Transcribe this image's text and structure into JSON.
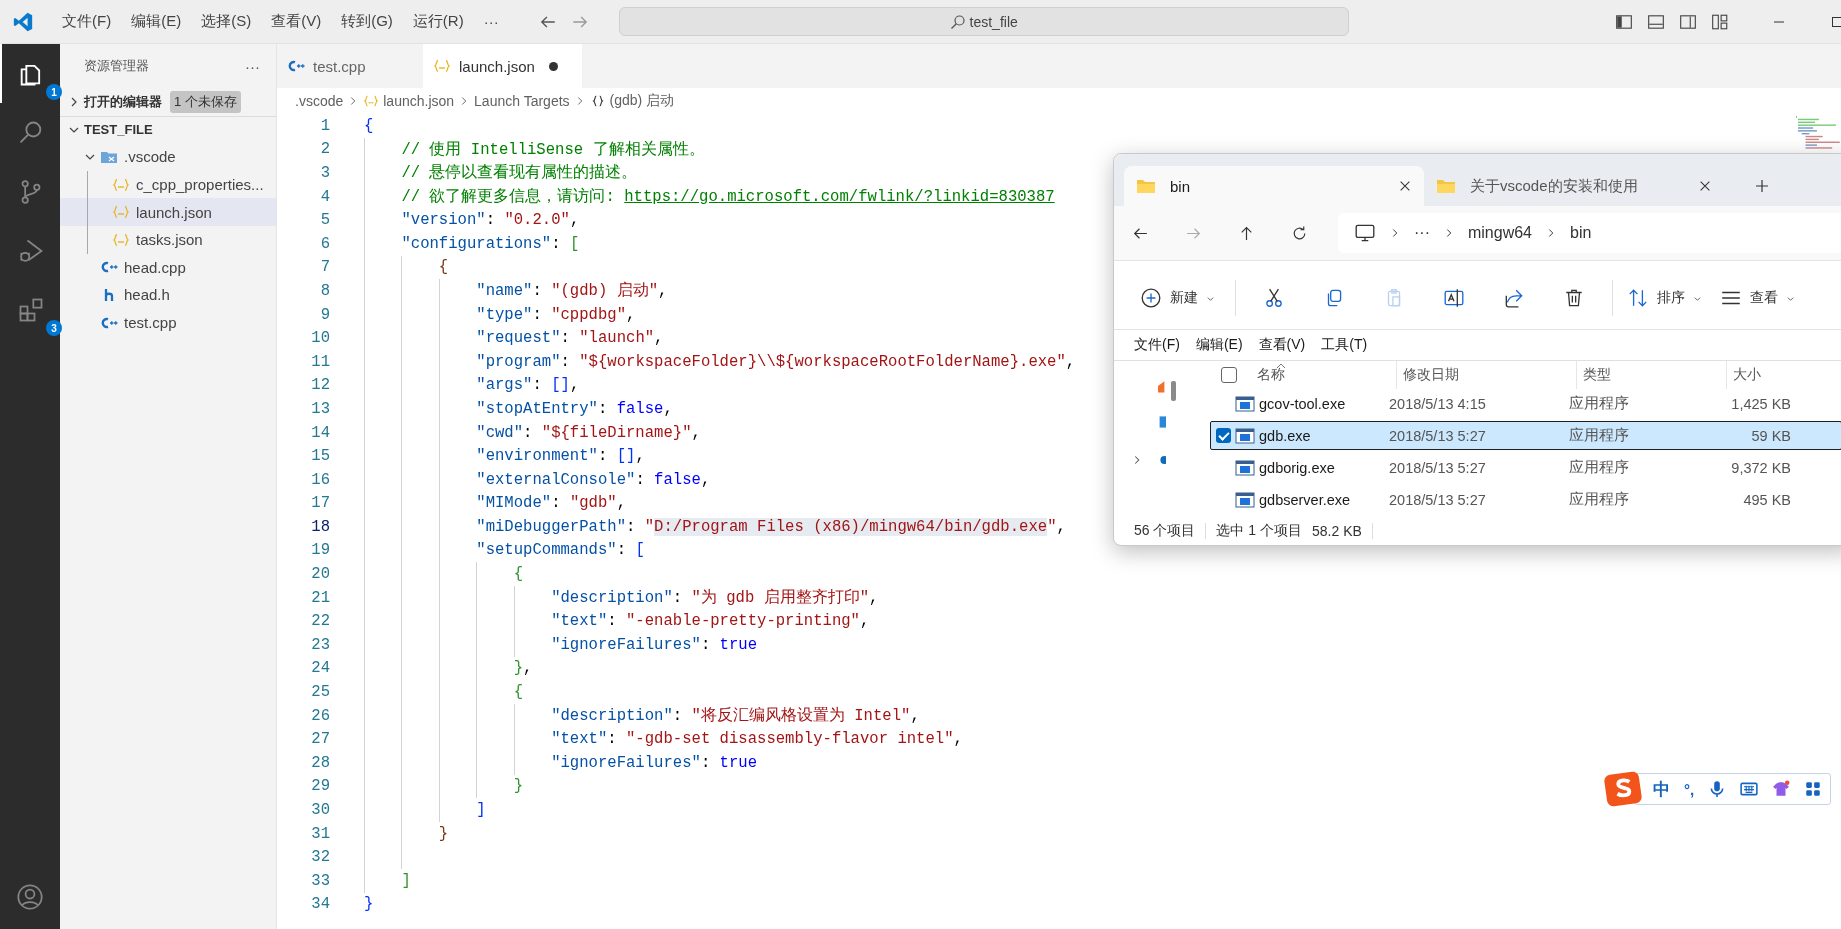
{
  "title_bar": {
    "menu": [
      "文件(F)",
      "编辑(E)",
      "选择(S)",
      "查看(V)",
      "转到(G)",
      "运行(R)"
    ],
    "more": "···",
    "search": "test_file"
  },
  "activity_bar": {
    "items": [
      {
        "kind": "explorer",
        "selected": true,
        "badge": "1"
      },
      {
        "kind": "search",
        "selected": false
      },
      {
        "kind": "scm",
        "selected": false
      },
      {
        "kind": "debug",
        "selected": false
      },
      {
        "kind": "extensions",
        "selected": false,
        "badge": "3"
      }
    ]
  },
  "sidebar": {
    "title": "资源管理器",
    "more": "···",
    "open_editors": {
      "label": "打开的编辑器",
      "badge": "1 个未保存",
      "expanded": false
    },
    "root": {
      "label": "TEST_FILE",
      "expanded": true,
      "children": [
        {
          "name": ".vscode",
          "kind": "folder",
          "expanded": true,
          "selected": false,
          "children": [
            {
              "name": "c_cpp_properties...",
              "kind": "json",
              "selected": false
            },
            {
              "name": "launch.json",
              "kind": "json",
              "selected": true
            },
            {
              "name": "tasks.json",
              "kind": "json",
              "selected": false
            }
          ]
        },
        {
          "name": "head.cpp",
          "kind": "cpp",
          "selected": false
        },
        {
          "name": "head.h",
          "kind": "h",
          "selected": false
        },
        {
          "name": "test.cpp",
          "kind": "cpp",
          "selected": false
        }
      ]
    }
  },
  "editor": {
    "tabs": [
      {
        "label": "test.cpp",
        "kind": "cpp",
        "selected": false,
        "dirty": false
      },
      {
        "label": "launch.json",
        "kind": "json",
        "selected": true,
        "dirty": true
      }
    ],
    "breadcrumb": [
      {
        "label": ".vscode",
        "kind": "text"
      },
      {
        "label": "launch.json",
        "kind": "json"
      },
      {
        "label": "Launch Targets",
        "kind": "text"
      },
      {
        "label": "(gdb) 启动",
        "kind": "object"
      }
    ],
    "lines": [
      {
        "n": "1",
        "current": false,
        "tokens": [
          {
            "kind": "bracket1",
            "text": "{"
          }
        ],
        "children": [
          {
            "n": "2",
            "current": false,
            "tokens": [
              {
                "kind": "comment",
                "text": "// 使用 IntelliSense 了解相关属性。"
              }
            ]
          },
          {
            "n": "3",
            "current": false,
            "tokens": [
              {
                "kind": "comment",
                "text": "// 悬停以查看现有属性的描述。"
              }
            ]
          },
          {
            "n": "4",
            "current": false,
            "tokens": [
              {
                "kind": "comment",
                "text": "// 欲了解更多信息，请访问: "
              },
              {
                "kind": "link",
                "text": "https://go.microsoft.com/fwlink/?linkid=830387"
              }
            ]
          },
          {
            "n": "5",
            "current": false,
            "tokens": [
              {
                "kind": "key",
                "text": "\"version\""
              },
              {
                "kind": "punct",
                "text": ": "
              },
              {
                "kind": "string",
                "text": "\"0.2.0\""
              },
              {
                "kind": "punct",
                "text": ","
              }
            ]
          },
          {
            "n": "6",
            "current": false,
            "tokens": [
              {
                "kind": "key",
                "text": "\"configurations\""
              },
              {
                "kind": "punct",
                "text": ": "
              },
              {
                "kind": "bracket2",
                "text": "["
              }
            ],
            "children": [
              {
                "n": "7",
                "current": false,
                "tokens": [
                  {
                    "kind": "bracket3",
                    "text": "{"
                  }
                ],
                "children": [
                  {
                    "n": "8",
                    "current": false,
                    "tokens": [
                      {
                        "kind": "key",
                        "text": "\"name\""
                      },
                      {
                        "kind": "punct",
                        "text": ": "
                      },
                      {
                        "kind": "string",
                        "text": "\"(gdb) 启动\""
                      },
                      {
                        "kind": "punct",
                        "text": ","
                      }
                    ]
                  },
                  {
                    "n": "9",
                    "current": false,
                    "tokens": [
                      {
                        "kind": "key",
                        "text": "\"type\""
                      },
                      {
                        "kind": "punct",
                        "text": ": "
                      },
                      {
                        "kind": "string",
                        "text": "\"cppdbg\""
                      },
                      {
                        "kind": "punct",
                        "text": ","
                      }
                    ]
                  },
                  {
                    "n": "10",
                    "current": false,
                    "tokens": [
                      {
                        "kind": "key",
                        "text": "\"request\""
                      },
                      {
                        "kind": "punct",
                        "text": ": "
                      },
                      {
                        "kind": "string",
                        "text": "\"launch\""
                      },
                      {
                        "kind": "punct",
                        "text": ","
                      }
                    ]
                  },
                  {
                    "n": "11",
                    "current": false,
                    "tokens": [
                      {
                        "kind": "key",
                        "text": "\"program\""
                      },
                      {
                        "kind": "punct",
                        "text": ": "
                      },
                      {
                        "kind": "string",
                        "text": "\"${workspaceFolder}\\\\${workspaceRootFolderName}.exe\""
                      },
                      {
                        "kind": "punct",
                        "text": ","
                      }
                    ]
                  },
                  {
                    "n": "12",
                    "current": false,
                    "tokens": [
                      {
                        "kind": "key",
                        "text": "\"args\""
                      },
                      {
                        "kind": "punct",
                        "text": ": "
                      },
                      {
                        "kind": "bracket1",
                        "text": "[]"
                      },
                      {
                        "kind": "punct",
                        "text": ","
                      }
                    ]
                  },
                  {
                    "n": "13",
                    "current": false,
                    "tokens": [
                      {
                        "kind": "key",
                        "text": "\"stopAtEntry\""
                      },
                      {
                        "kind": "punct",
                        "text": ": "
                      },
                      {
                        "kind": "bool",
                        "text": "false"
                      },
                      {
                        "kind": "punct",
                        "text": ","
                      }
                    ]
                  },
                  {
                    "n": "14",
                    "current": false,
                    "tokens": [
                      {
                        "kind": "key",
                        "text": "\"cwd\""
                      },
                      {
                        "kind": "punct",
                        "text": ": "
                      },
                      {
                        "kind": "string",
                        "text": "\"${fileDirname}\""
                      },
                      {
                        "kind": "punct",
                        "text": ","
                      }
                    ]
                  },
                  {
                    "n": "15",
                    "current": false,
                    "tokens": [
                      {
                        "kind": "key",
                        "text": "\"environment\""
                      },
                      {
                        "kind": "punct",
                        "text": ": "
                      },
                      {
                        "kind": "bracket1",
                        "text": "[]"
                      },
                      {
                        "kind": "punct",
                        "text": ","
                      }
                    ]
                  },
                  {
                    "n": "16",
                    "current": false,
                    "tokens": [
                      {
                        "kind": "key",
                        "text": "\"externalConsole\""
                      },
                      {
                        "kind": "punct",
                        "text": ": "
                      },
                      {
                        "kind": "bool",
                        "text": "false"
                      },
                      {
                        "kind": "punct",
                        "text": ","
                      }
                    ]
                  },
                  {
                    "n": "17",
                    "current": false,
                    "tokens": [
                      {
                        "kind": "key",
                        "text": "\"MIMode\""
                      },
                      {
                        "kind": "punct",
                        "text": ": "
                      },
                      {
                        "kind": "string",
                        "text": "\"gdb\""
                      },
                      {
                        "kind": "punct",
                        "text": ","
                      }
                    ]
                  },
                  {
                    "n": "18",
                    "current": true,
                    "tokens": [
                      {
                        "kind": "key",
                        "text": "\"miDebuggerPath\""
                      },
                      {
                        "kind": "punct",
                        "text": ": "
                      },
                      {
                        "kind": "string",
                        "text": "\""
                      },
                      {
                        "kind": "string-selected",
                        "text": "D:/Program Files (x86)/mingw64/bin/gdb.exe"
                      },
                      {
                        "kind": "string",
                        "text": "\""
                      },
                      {
                        "kind": "punct",
                        "text": ","
                      }
                    ]
                  },
                  {
                    "n": "19",
                    "current": false,
                    "tokens": [
                      {
                        "kind": "key",
                        "text": "\"setupCommands\""
                      },
                      {
                        "kind": "punct",
                        "text": ": "
                      },
                      {
                        "kind": "bracket1",
                        "text": "["
                      }
                    ],
                    "children": [
                      {
                        "n": "20",
                        "current": false,
                        "tokens": [
                          {
                            "kind": "bracket2",
                            "text": "{"
                          }
                        ],
                        "children": [
                          {
                            "n": "21",
                            "current": false,
                            "tokens": [
                              {
                                "kind": "key",
                                "text": "\"description\""
                              },
                              {
                                "kind": "punct",
                                "text": ": "
                              },
                              {
                                "kind": "string",
                                "text": "\"为 gdb 启用整齐打印\""
                              },
                              {
                                "kind": "punct",
                                "text": ","
                              }
                            ]
                          },
                          {
                            "n": "22",
                            "current": false,
                            "tokens": [
                              {
                                "kind": "key",
                                "text": "\"text\""
                              },
                              {
                                "kind": "punct",
                                "text": ": "
                              },
                              {
                                "kind": "string",
                                "text": "\"-enable-pretty-printing\""
                              },
                              {
                                "kind": "punct",
                                "text": ","
                              }
                            ]
                          },
                          {
                            "n": "23",
                            "current": false,
                            "tokens": [
                              {
                                "kind": "key",
                                "text": "\"ignoreFailures\""
                              },
                              {
                                "kind": "punct",
                                "text": ": "
                              },
                              {
                                "kind": "bool",
                                "text": "true"
                              }
                            ]
                          }
                        ]
                      },
                      {
                        "n": "24",
                        "current": false,
                        "tokens": [
                          {
                            "kind": "bracket2",
                            "text": "}"
                          },
                          {
                            "kind": "punct",
                            "text": ","
                          }
                        ]
                      },
                      {
                        "n": "25",
                        "current": false,
                        "tokens": [
                          {
                            "kind": "bracket2",
                            "text": "{"
                          }
                        ],
                        "children": [
                          {
                            "n": "26",
                            "current": false,
                            "tokens": [
                              {
                                "kind": "key",
                                "text": "\"description\""
                              },
                              {
                                "kind": "punct",
                                "text": ": "
                              },
                              {
                                "kind": "string",
                                "text": "\"将反汇编风格设置为 Intel\""
                              },
                              {
                                "kind": "punct",
                                "text": ","
                              }
                            ]
                          },
                          {
                            "n": "27",
                            "current": false,
                            "tokens": [
                              {
                                "kind": "key",
                                "text": "\"text\""
                              },
                              {
                                "kind": "punct",
                                "text": ": "
                              },
                              {
                                "kind": "string",
                                "text": "\"-gdb-set disassembly-flavor intel\""
                              },
                              {
                                "kind": "punct",
                                "text": ","
                              }
                            ]
                          },
                          {
                            "n": "28",
                            "current": false,
                            "tokens": [
                              {
                                "kind": "key",
                                "text": "\"ignoreFailures\""
                              },
                              {
                                "kind": "punct",
                                "text": ": "
                              },
                              {
                                "kind": "bool",
                                "text": "true"
                              }
                            ]
                          }
                        ]
                      },
                      {
                        "n": "29",
                        "current": false,
                        "tokens": [
                          {
                            "kind": "bracket2",
                            "text": "}"
                          }
                        ]
                      }
                    ]
                  },
                  {
                    "n": "30",
                    "current": false,
                    "tokens": [
                      {
                        "kind": "bracket1",
                        "text": "]"
                      }
                    ]
                  }
                ]
              },
              {
                "n": "31",
                "current": false,
                "tokens": [
                  {
                    "kind": "bracket3",
                    "text": "}"
                  }
                ]
              },
              {
                "n": "32",
                "current": false
              }
            ]
          },
          {
            "n": "33",
            "current": false,
            "tokens": [
              {
                "kind": "bracket2",
                "text": "]"
              }
            ]
          }
        ]
      },
      {
        "n": "34",
        "current": false,
        "tokens": [
          {
            "kind": "bracket1",
            "text": "}"
          }
        ]
      }
    ]
  },
  "file_explorer": {
    "tabs": [
      {
        "title": "bin",
        "selected": true
      },
      {
        "title": "关于vscode的安装和使用",
        "selected": false
      }
    ],
    "address": [
      "···",
      "mingw64",
      "bin"
    ],
    "toolbar": [
      {
        "kind": "new",
        "label": "新建",
        "disabled": false
      },
      {
        "kind": "cut",
        "disabled": false
      },
      {
        "kind": "copy",
        "disabled": false
      },
      {
        "kind": "paste",
        "disabled": true
      },
      {
        "kind": "rename",
        "disabled": false
      },
      {
        "kind": "share",
        "disabled": false
      },
      {
        "kind": "delete",
        "disabled": false
      },
      {
        "kind": "sort",
        "label": "排序",
        "disabled": false
      },
      {
        "kind": "view",
        "label": "查看",
        "disabled": false
      }
    ],
    "menu": [
      "文件(F)",
      "编辑(E)",
      "查看(V)",
      "工具(T)"
    ],
    "select_all": false,
    "columns": [
      "名称",
      "修改日期",
      "类型",
      "大小"
    ],
    "rows": [
      {
        "name": "gcov-tool.exe",
        "modified": "2018/5/13 4:15",
        "type": "应用程序",
        "size": "1,425 KB",
        "selected": false
      },
      {
        "name": "gdb.exe",
        "modified": "2018/5/13 5:27",
        "type": "应用程序",
        "size": "59 KB",
        "selected": true
      },
      {
        "name": "gdborig.exe",
        "modified": "2018/5/13 5:27",
        "type": "应用程序",
        "size": "9,372 KB",
        "selected": false
      },
      {
        "name": "gdbserver.exe",
        "modified": "2018/5/13 5:27",
        "type": "应用程序",
        "size": "495 KB",
        "selected": false
      }
    ],
    "status": {
      "count": "56 个项目",
      "selection": "选中 1 个项目",
      "size": "58.2 KB"
    }
  },
  "ime": {
    "mode": "中",
    "punctuation": "°,"
  }
}
